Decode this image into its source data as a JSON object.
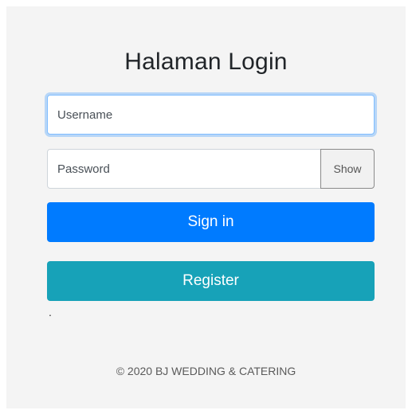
{
  "login": {
    "title": "Halaman Login",
    "username_placeholder": "Username",
    "password_placeholder": "Password",
    "show_label": "Show",
    "signin_label": "Sign in",
    "register_label": "Register",
    "dot": ".",
    "footer": "© 2020 BJ WEDDING & CATERING"
  },
  "colors": {
    "primary": "#007bff",
    "info": "#17a2b8",
    "card_background": "#f4f4f4"
  }
}
